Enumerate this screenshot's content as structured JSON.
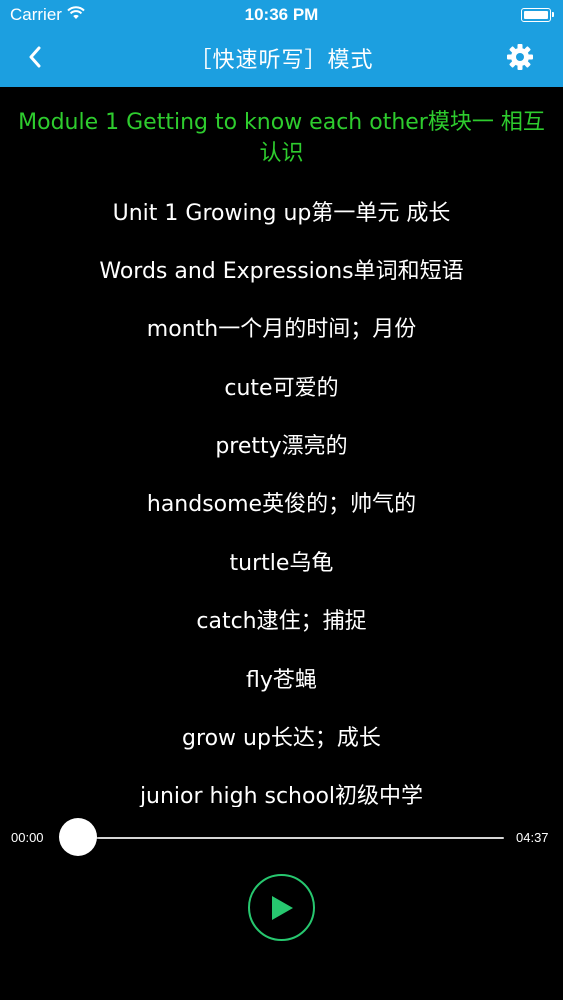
{
  "status_bar": {
    "carrier": "Carrier",
    "time": "10:36 PM",
    "battery_level": 1.0
  },
  "nav": {
    "title": "［快速听写］模式",
    "back_icon": "chevron-left-icon",
    "settings_icon": "gear-icon"
  },
  "content": {
    "heading": "Module 1 Getting to know each other模块一 相互认识",
    "lines": [
      "Unit 1 Growing up第一单元 成长",
      "Words and Expressions单词和短语",
      "month一个月的时间；月份",
      "cute可爱的",
      "pretty漂亮的",
      "handsome英俊的；帅气的",
      "turtle乌龟",
      "catch逮住；捕捉",
      "fly苍蝇",
      "grow up长达；成长",
      "junior high school初级中学"
    ]
  },
  "player": {
    "current_time": "00:00",
    "total_time": "04:37",
    "progress": 0.0,
    "play_icon": "play-icon"
  },
  "colors": {
    "nav_bar": "#1c9fe0",
    "background": "#000000",
    "heading_text": "#2ecc2e",
    "play_button_accent": "#27c76f"
  }
}
